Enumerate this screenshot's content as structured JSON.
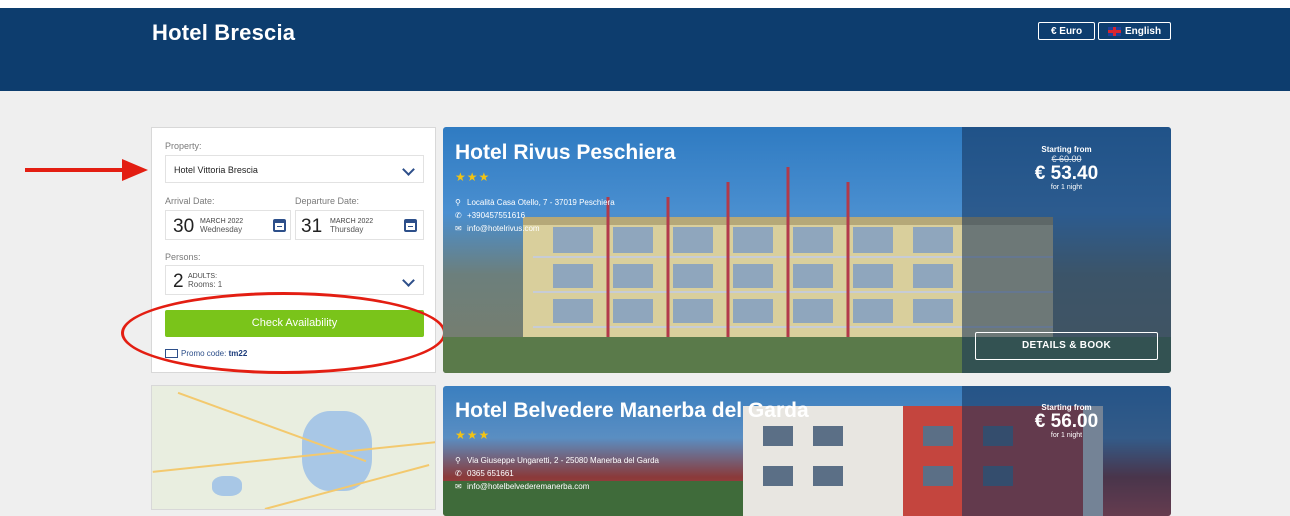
{
  "header": {
    "brand": "Hotel Brescia",
    "currency_label": "€ Euro",
    "language_label": "English"
  },
  "search": {
    "property_label": "Property:",
    "property_value": "Hotel Vittoria Brescia",
    "arrival_label": "Arrival Date:",
    "arrival_day": "30",
    "arrival_month": "MARCH 2022",
    "arrival_weekday": "Wednesday",
    "departure_label": "Departure Date:",
    "departure_day": "31",
    "departure_month": "MARCH 2022",
    "departure_weekday": "Thursday",
    "persons_label": "Persons:",
    "persons_count": "2",
    "persons_unit": "ADULTS:",
    "rooms": "Rooms: 1",
    "check_label": "Check Availability",
    "promo_prefix": "Promo code:",
    "promo_code": "tm22"
  },
  "hotels": [
    {
      "name": "Hotel Rivus Peschiera",
      "stars": "★★★",
      "address": "Località Casa Otello, 7 - 37019 Peschiera",
      "phone": "+390457551616",
      "email": "info@hotelrivus.com",
      "starting_from": "Starting from",
      "old_price": "€ 60.00",
      "price": "€ 53.40",
      "nights": "for 1 night",
      "details_label": "DETAILS & BOOK"
    },
    {
      "name": "Hotel Belvedere Manerba del Garda",
      "stars": "★★★",
      "address": "Via Giuseppe Ungaretti, 2 - 25080 Manerba del Garda",
      "phone": "0365 651661",
      "email": "info@hotelbelvederemanerba.com",
      "starting_from": "Starting from",
      "price": "€ 56.00",
      "nights": "for 1 night"
    }
  ],
  "colors": {
    "header_bg": "#0d3d6e",
    "check_button": "#7ac41a",
    "annotation_red": "#e31e12",
    "stars": "#f2c314"
  }
}
